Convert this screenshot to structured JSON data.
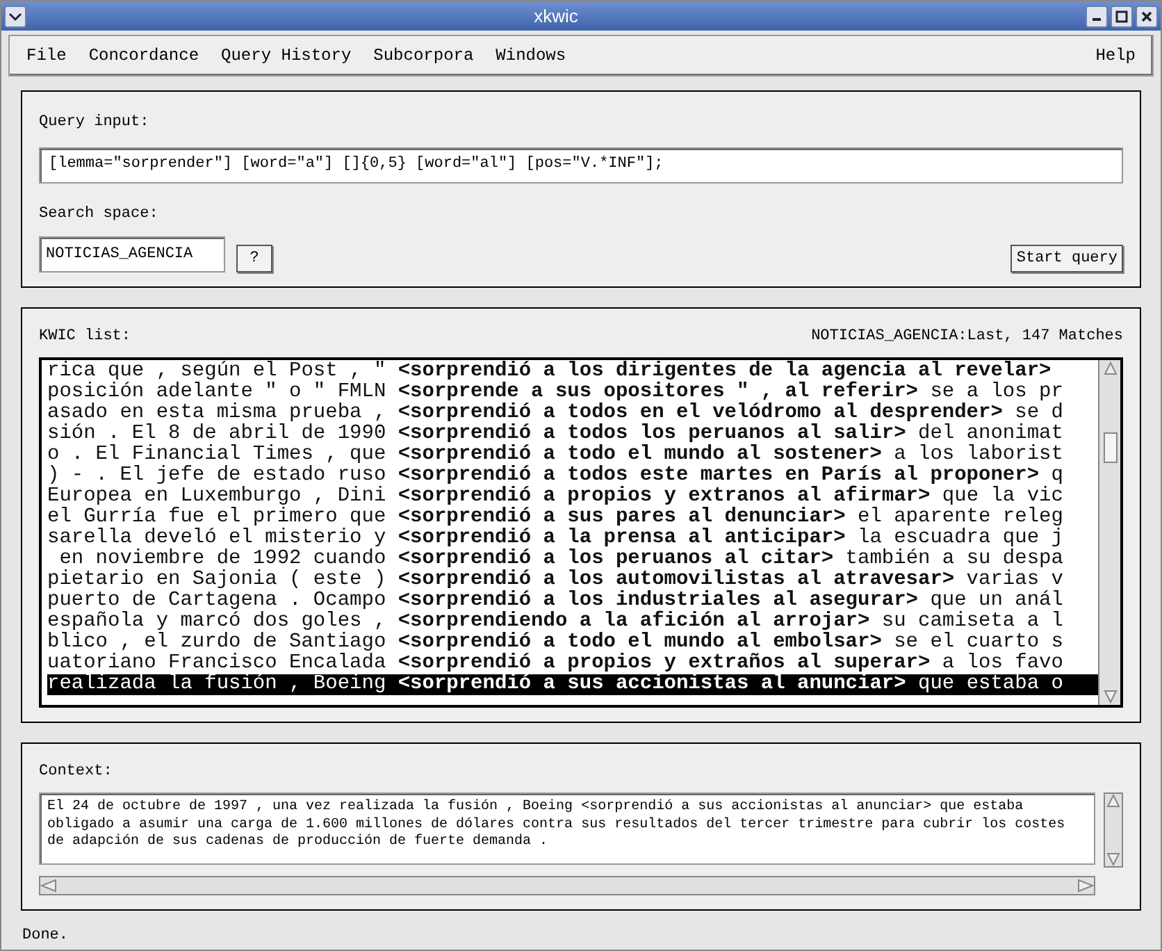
{
  "window": {
    "title": "xkwic"
  },
  "menu": [
    {
      "label": "File"
    },
    {
      "label": "Concordance"
    },
    {
      "label": "Query History"
    },
    {
      "label": "Subcorpora"
    },
    {
      "label": "Windows"
    },
    {
      "label": "Help"
    }
  ],
  "query": {
    "label": "Query input:",
    "value": "[lemma=\"sorprender\"] [word=\"a\"] []{0,5} [word=\"al\"] [pos=\"V.*INF\"];"
  },
  "search_space": {
    "label": "Search space:",
    "value": "NOTICIAS_AGENCIA",
    "help_button": "?",
    "start_button": "Start query"
  },
  "kwic": {
    "label": "KWIC list:",
    "info": "NOTICIAS_AGENCIA:Last, 147 Matches",
    "rows": [
      {
        "left": "rica que , según el Post , \"",
        "keyword": "<sorprendió a los dirigentes de la agencia al revelar>",
        "right": "",
        "selected": false
      },
      {
        "left": "posición adelante \" o \" FMLN",
        "keyword": "<sorprende a sus opositores \" , al referir>",
        "right": "se a los pr",
        "selected": false
      },
      {
        "left": "asado en esta misma prueba ,",
        "keyword": "<sorprendió a todos en el velódromo al desprender>",
        "right": "se d",
        "selected": false
      },
      {
        "left": "sión . El 8 de abril de 1990",
        "keyword": "<sorprendió a todos los peruanos al salir>",
        "right": "del anonimat",
        "selected": false
      },
      {
        "left": "o . El Financial Times , que",
        "keyword": "<sorprendió a todo el mundo al sostener>",
        "right": "a los laborist",
        "selected": false
      },
      {
        "left": ") - . El jefe de estado ruso",
        "keyword": "<sorprendió a todos este martes en París al proponer>",
        "right": "q",
        "selected": false
      },
      {
        "left": "Europea en Luxemburgo , Dini",
        "keyword": "<sorprendió a propios y extranos al afirmar>",
        "right": "que la vic",
        "selected": false
      },
      {
        "left": "el Gurría fue el primero que",
        "keyword": "<sorprendió a sus pares al denunciar>",
        "right": "el aparente releg",
        "selected": false
      },
      {
        "left": "sarella develó el misterio y",
        "keyword": "<sorprendió a la prensa al anticipar>",
        "right": "la escuadra que j",
        "selected": false
      },
      {
        "left": " en noviembre de 1992 cuando",
        "keyword": "<sorprendió a los peruanos al citar>",
        "right": "también a su despa",
        "selected": false
      },
      {
        "left": "pietario en Sajonia ( este )",
        "keyword": "<sorprendió a los automovilistas al atravesar>",
        "right": "varias v",
        "selected": false
      },
      {
        "left": "puerto de Cartagena . Ocampo",
        "keyword": "<sorprendió a los industriales al asegurar>",
        "right": "que un anál",
        "selected": false
      },
      {
        "left": "española y marcó dos goles ,",
        "keyword": "<sorprendiendo a la afición al arrojar>",
        "right": "su camiseta a l",
        "selected": false
      },
      {
        "left": "blico , el zurdo de Santiago",
        "keyword": "<sorprendió a todo el mundo al embolsar>",
        "right": "se el cuarto s",
        "selected": false
      },
      {
        "left": "uatoriano Francisco Encalada",
        "keyword": "<sorprendió a propios y extraños al superar>",
        "right": "a los favo",
        "selected": false
      },
      {
        "left": "realizada la fusión , Boeing",
        "keyword": "<sorprendió a sus accionistas al anunciar>",
        "right": "que estaba o",
        "selected": true
      }
    ]
  },
  "context": {
    "label": "Context:",
    "text": "El 24 de octubre de 1997 , una vez realizada la fusión , Boeing <sorprendió a sus accionistas al anunciar> que estaba obligado a asumir una carga de 1.600 millones de dólares contra sus resultados del tercer trimestre para cubrir los costes de adapción de sus cadenas de producción de fuerte demanda ."
  },
  "status_bar": "Done."
}
